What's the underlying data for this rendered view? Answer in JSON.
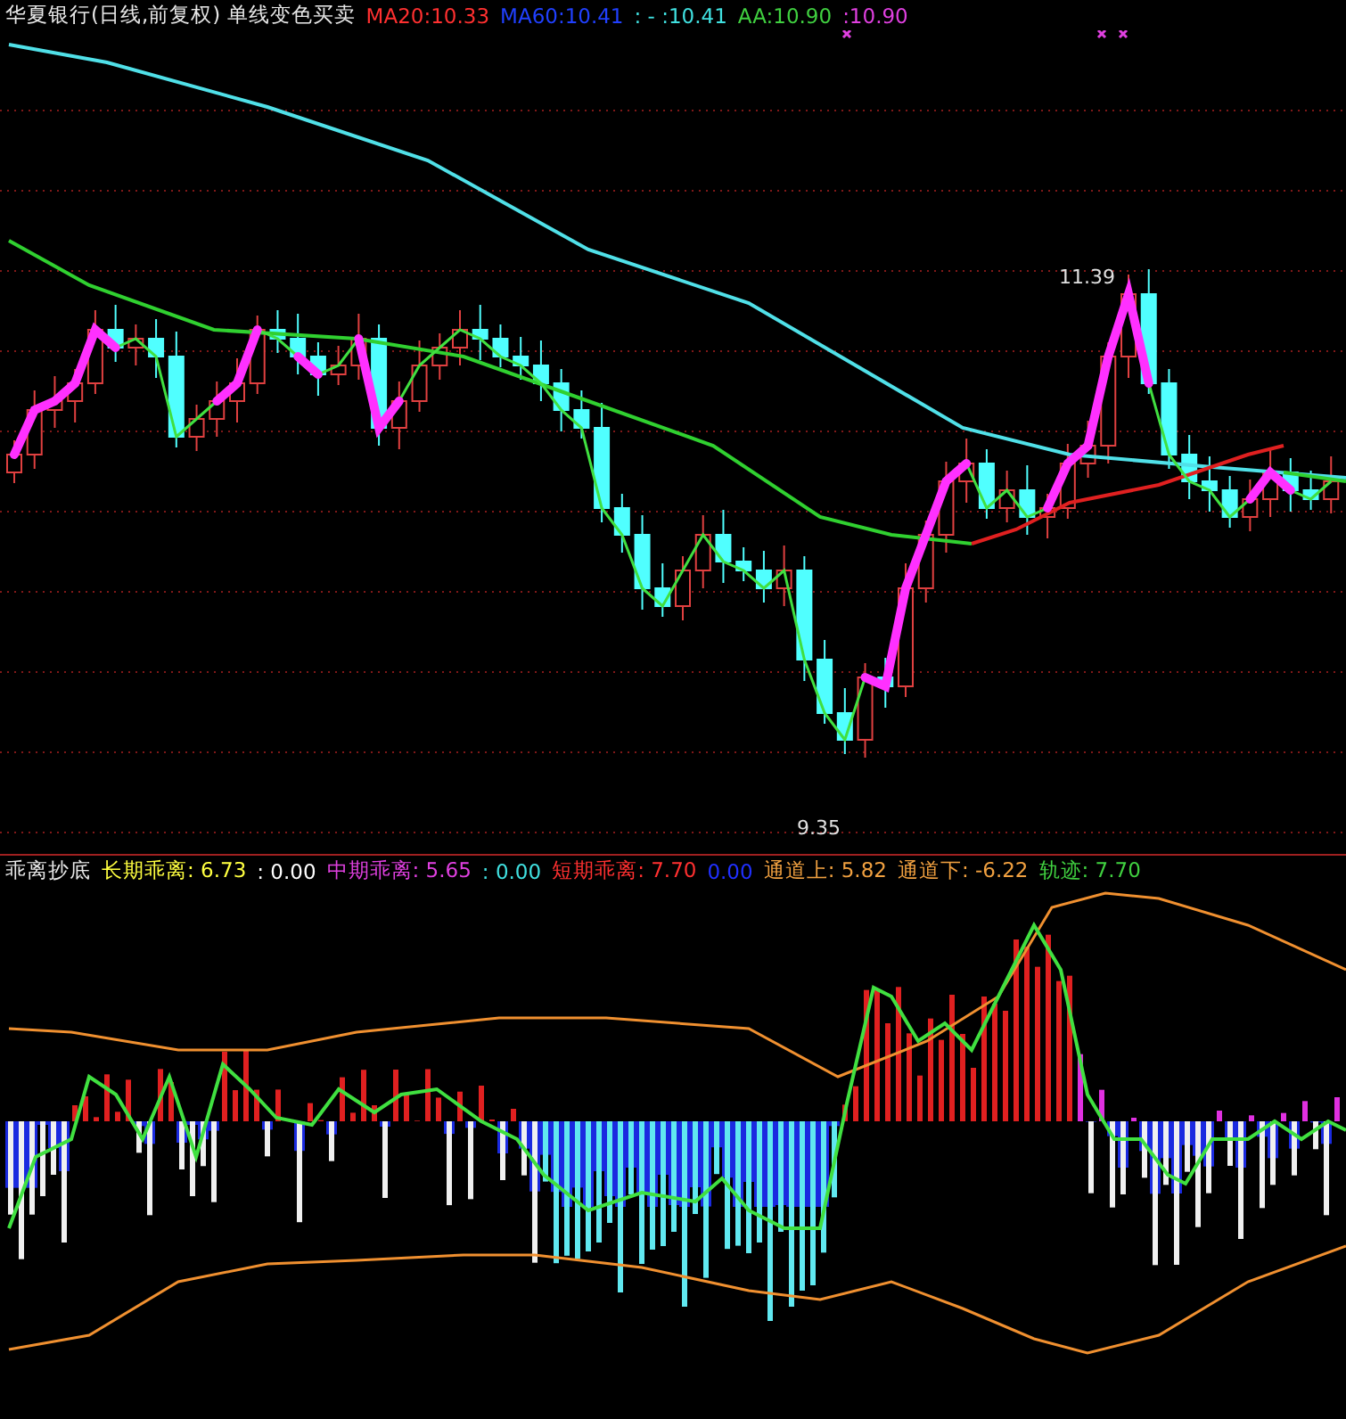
{
  "price_panel": {
    "title": "华夏银行(日线,前复权) 单线变色买卖",
    "items": [
      {
        "text": "MA20:10.33",
        "color": "#ff3030"
      },
      {
        "text": "MA60:10.41",
        "color": "#2040ff"
      },
      {
        "text": ": - :10.41",
        "color": "#40e0e0"
      },
      {
        "text": "AA:10.90",
        "color": "#40d040"
      },
      {
        "text": ":10.90",
        "color": "#e040e0"
      }
    ],
    "high_label": "11.39",
    "low_label": "9.35"
  },
  "indicator_panel": {
    "title": "乖离抄底",
    "items": [
      {
        "text": "长期乖离: 6.73",
        "color": "#ffff40"
      },
      {
        "text": ": 0.00",
        "color": "#ffffff"
      },
      {
        "text": "中期乖离: 5.65",
        "color": "#e040e0"
      },
      {
        "text": ": 0.00",
        "color": "#40e0e0"
      },
      {
        "text": "短期乖离: 7.70",
        "color": "#ff3030"
      },
      {
        "text": "0.00",
        "color": "#2030ff"
      },
      {
        "text": "通道上: 5.82",
        "color": "#f0a040"
      },
      {
        "text": "通道下: -6.22",
        "color": "#f0a040"
      },
      {
        "text": "轨迹: 7.70",
        "color": "#40d040"
      }
    ]
  }
}
